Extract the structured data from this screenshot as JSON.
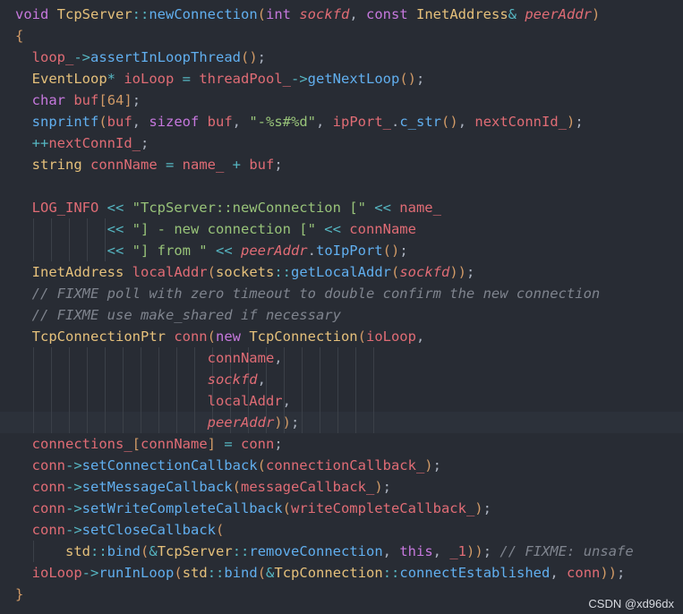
{
  "theme": {
    "background": "#282c34",
    "colors": {
      "kw": "#c678dd",
      "type": "#e5c07b",
      "fn": "#61afef",
      "var": "#e06c75",
      "param": "#e06c75",
      "str": "#98c379",
      "punc": "#abb2bf",
      "op": "#56b6c2",
      "num": "#d19a66",
      "cmt": "#7f848e",
      "plain": "#abb2bf",
      "brk": "#d19a66"
    }
  },
  "code_lines": [
    {
      "tokens": [
        [
          "void ",
          "kw"
        ],
        [
          "TcpServer",
          "type"
        ],
        [
          "::",
          "op"
        ],
        [
          "newConnection",
          "fn"
        ],
        [
          "(",
          "brk"
        ],
        [
          "int ",
          "kw"
        ],
        [
          "sockfd",
          "param"
        ],
        [
          ", ",
          "punc"
        ],
        [
          "const ",
          "kw"
        ],
        [
          "InetAddress",
          "type"
        ],
        [
          "& ",
          "op"
        ],
        [
          "peerAddr",
          "param"
        ],
        [
          ")",
          "brk"
        ]
      ]
    },
    {
      "tokens": [
        [
          "{",
          "brk"
        ]
      ]
    },
    {
      "tokens": [
        [
          "  ",
          "plain"
        ],
        [
          "loop_",
          "var"
        ],
        [
          "->",
          "op"
        ],
        [
          "assertInLoopThread",
          "fn"
        ],
        [
          "()",
          "brk"
        ],
        [
          ";",
          "punc"
        ]
      ]
    },
    {
      "tokens": [
        [
          "  ",
          "plain"
        ],
        [
          "EventLoop",
          "type"
        ],
        [
          "* ",
          "op"
        ],
        [
          "ioLoop",
          "var"
        ],
        [
          " = ",
          "op"
        ],
        [
          "threadPool_",
          "var"
        ],
        [
          "->",
          "op"
        ],
        [
          "getNextLoop",
          "fn"
        ],
        [
          "()",
          "brk"
        ],
        [
          ";",
          "punc"
        ]
      ]
    },
    {
      "tokens": [
        [
          "  ",
          "plain"
        ],
        [
          "char ",
          "kw"
        ],
        [
          "buf",
          "var"
        ],
        [
          "[",
          "brk"
        ],
        [
          "64",
          "num"
        ],
        [
          "]",
          "brk"
        ],
        [
          ";",
          "punc"
        ]
      ]
    },
    {
      "tokens": [
        [
          "  ",
          "plain"
        ],
        [
          "snprintf",
          "fn"
        ],
        [
          "(",
          "brk"
        ],
        [
          "buf",
          "var"
        ],
        [
          ", ",
          "punc"
        ],
        [
          "sizeof ",
          "kw"
        ],
        [
          "buf",
          "var"
        ],
        [
          ", ",
          "punc"
        ],
        [
          "\"-%s#%d\"",
          "str"
        ],
        [
          ", ",
          "punc"
        ],
        [
          "ipPort_",
          "var"
        ],
        [
          ".",
          "punc"
        ],
        [
          "c_str",
          "fn"
        ],
        [
          "()",
          "brk"
        ],
        [
          ", ",
          "punc"
        ],
        [
          "nextConnId_",
          "var"
        ],
        [
          ")",
          "brk"
        ],
        [
          ";",
          "punc"
        ]
      ]
    },
    {
      "tokens": [
        [
          "  ",
          "plain"
        ],
        [
          "++",
          "op"
        ],
        [
          "nextConnId_",
          "var"
        ],
        [
          ";",
          "punc"
        ]
      ]
    },
    {
      "tokens": [
        [
          "  ",
          "plain"
        ],
        [
          "string ",
          "type"
        ],
        [
          "connName",
          "var"
        ],
        [
          " = ",
          "op"
        ],
        [
          "name_",
          "var"
        ],
        [
          " + ",
          "op"
        ],
        [
          "buf",
          "var"
        ],
        [
          ";",
          "punc"
        ]
      ]
    },
    {
      "tokens": []
    },
    {
      "tokens": [
        [
          "  ",
          "plain"
        ],
        [
          "LOG_INFO",
          "var"
        ],
        [
          " << ",
          "op"
        ],
        [
          "\"TcpServer::newConnection [\"",
          "str"
        ],
        [
          " << ",
          "op"
        ],
        [
          "name_",
          "var"
        ]
      ]
    },
    {
      "tokens": [
        [
          "           ",
          "plain"
        ],
        [
          "<< ",
          "op"
        ],
        [
          "\"] - new connection [\"",
          "str"
        ],
        [
          " << ",
          "op"
        ],
        [
          "connName",
          "var"
        ]
      ]
    },
    {
      "tokens": [
        [
          "           ",
          "plain"
        ],
        [
          "<< ",
          "op"
        ],
        [
          "\"] from \"",
          "str"
        ],
        [
          " << ",
          "op"
        ],
        [
          "peerAddr",
          "param"
        ],
        [
          ".",
          "punc"
        ],
        [
          "toIpPort",
          "fn"
        ],
        [
          "()",
          "brk"
        ],
        [
          ";",
          "punc"
        ]
      ]
    },
    {
      "tokens": [
        [
          "  ",
          "plain"
        ],
        [
          "InetAddress ",
          "type"
        ],
        [
          "localAddr",
          "var"
        ],
        [
          "(",
          "brk"
        ],
        [
          "sockets",
          "type"
        ],
        [
          "::",
          "op"
        ],
        [
          "getLocalAddr",
          "fn"
        ],
        [
          "(",
          "brk"
        ],
        [
          "sockfd",
          "param"
        ],
        [
          ")",
          "brk"
        ],
        [
          ")",
          "brk"
        ],
        [
          ";",
          "punc"
        ]
      ]
    },
    {
      "tokens": [
        [
          "  ",
          "plain"
        ],
        [
          "// FIXME poll with zero timeout to double confirm the new connection",
          "cmt"
        ]
      ]
    },
    {
      "tokens": [
        [
          "  ",
          "plain"
        ],
        [
          "// FIXME use make_shared if necessary",
          "cmt"
        ]
      ]
    },
    {
      "tokens": [
        [
          "  ",
          "plain"
        ],
        [
          "TcpConnectionPtr ",
          "type"
        ],
        [
          "conn",
          "var"
        ],
        [
          "(",
          "brk"
        ],
        [
          "new ",
          "kw"
        ],
        [
          "TcpConnection",
          "type"
        ],
        [
          "(",
          "brk"
        ],
        [
          "ioLoop",
          "var"
        ],
        [
          ",",
          "punc"
        ]
      ]
    },
    {
      "tokens": [
        [
          "                       ",
          "plain"
        ],
        [
          "connName",
          "var"
        ],
        [
          ",",
          "punc"
        ]
      ]
    },
    {
      "tokens": [
        [
          "                       ",
          "plain"
        ],
        [
          "sockfd",
          "param"
        ],
        [
          ",",
          "punc"
        ]
      ]
    },
    {
      "tokens": [
        [
          "                       ",
          "plain"
        ],
        [
          "localAddr",
          "var"
        ],
        [
          ",",
          "punc"
        ]
      ]
    },
    {
      "tokens": [
        [
          "                       ",
          "plain"
        ],
        [
          "peerAddr",
          "param"
        ],
        [
          ")",
          "brk"
        ],
        [
          ")",
          "brk"
        ],
        [
          ";",
          "punc"
        ]
      ]
    },
    {
      "tokens": [
        [
          "  ",
          "plain"
        ],
        [
          "connections_",
          "var"
        ],
        [
          "[",
          "brk"
        ],
        [
          "connName",
          "var"
        ],
        [
          "]",
          "brk"
        ],
        [
          " = ",
          "op"
        ],
        [
          "conn",
          "var"
        ],
        [
          ";",
          "punc"
        ]
      ]
    },
    {
      "tokens": [
        [
          "  ",
          "plain"
        ],
        [
          "conn",
          "var"
        ],
        [
          "->",
          "op"
        ],
        [
          "setConnectionCallback",
          "fn"
        ],
        [
          "(",
          "brk"
        ],
        [
          "connectionCallback_",
          "var"
        ],
        [
          ")",
          "brk"
        ],
        [
          ";",
          "punc"
        ]
      ]
    },
    {
      "tokens": [
        [
          "  ",
          "plain"
        ],
        [
          "conn",
          "var"
        ],
        [
          "->",
          "op"
        ],
        [
          "setMessageCallback",
          "fn"
        ],
        [
          "(",
          "brk"
        ],
        [
          "messageCallback_",
          "var"
        ],
        [
          ")",
          "brk"
        ],
        [
          ";",
          "punc"
        ]
      ]
    },
    {
      "tokens": [
        [
          "  ",
          "plain"
        ],
        [
          "conn",
          "var"
        ],
        [
          "->",
          "op"
        ],
        [
          "setWriteCompleteCallback",
          "fn"
        ],
        [
          "(",
          "brk"
        ],
        [
          "writeCompleteCallback_",
          "var"
        ],
        [
          ")",
          "brk"
        ],
        [
          ";",
          "punc"
        ]
      ]
    },
    {
      "tokens": [
        [
          "  ",
          "plain"
        ],
        [
          "conn",
          "var"
        ],
        [
          "->",
          "op"
        ],
        [
          "setCloseCallback",
          "fn"
        ],
        [
          "(",
          "brk"
        ]
      ]
    },
    {
      "tokens": [
        [
          "      ",
          "plain"
        ],
        [
          "std",
          "type"
        ],
        [
          "::",
          "op"
        ],
        [
          "bind",
          "fn"
        ],
        [
          "(",
          "brk"
        ],
        [
          "&",
          "op"
        ],
        [
          "TcpServer",
          "type"
        ],
        [
          "::",
          "op"
        ],
        [
          "removeConnection",
          "fn"
        ],
        [
          ", ",
          "punc"
        ],
        [
          "this",
          "kw"
        ],
        [
          ", ",
          "punc"
        ],
        [
          "_1",
          "var"
        ],
        [
          ")",
          "brk"
        ],
        [
          ")",
          "brk"
        ],
        [
          "; ",
          "punc"
        ],
        [
          "// FIXME: unsafe",
          "cmt"
        ]
      ]
    },
    {
      "tokens": [
        [
          "  ",
          "plain"
        ],
        [
          "ioLoop",
          "var"
        ],
        [
          "->",
          "op"
        ],
        [
          "runInLoop",
          "fn"
        ],
        [
          "(",
          "brk"
        ],
        [
          "std",
          "type"
        ],
        [
          "::",
          "op"
        ],
        [
          "bind",
          "fn"
        ],
        [
          "(",
          "brk"
        ],
        [
          "&",
          "op"
        ],
        [
          "TcpConnection",
          "type"
        ],
        [
          "::",
          "op"
        ],
        [
          "connectEstablished",
          "fn"
        ],
        [
          ", ",
          "punc"
        ],
        [
          "conn",
          "var"
        ],
        [
          ")",
          "brk"
        ],
        [
          ")",
          "brk"
        ],
        [
          ";",
          "punc"
        ]
      ]
    },
    {
      "tokens": [
        [
          "}",
          "brk"
        ]
      ]
    }
  ],
  "watermark": "CSDN @xd96dx"
}
